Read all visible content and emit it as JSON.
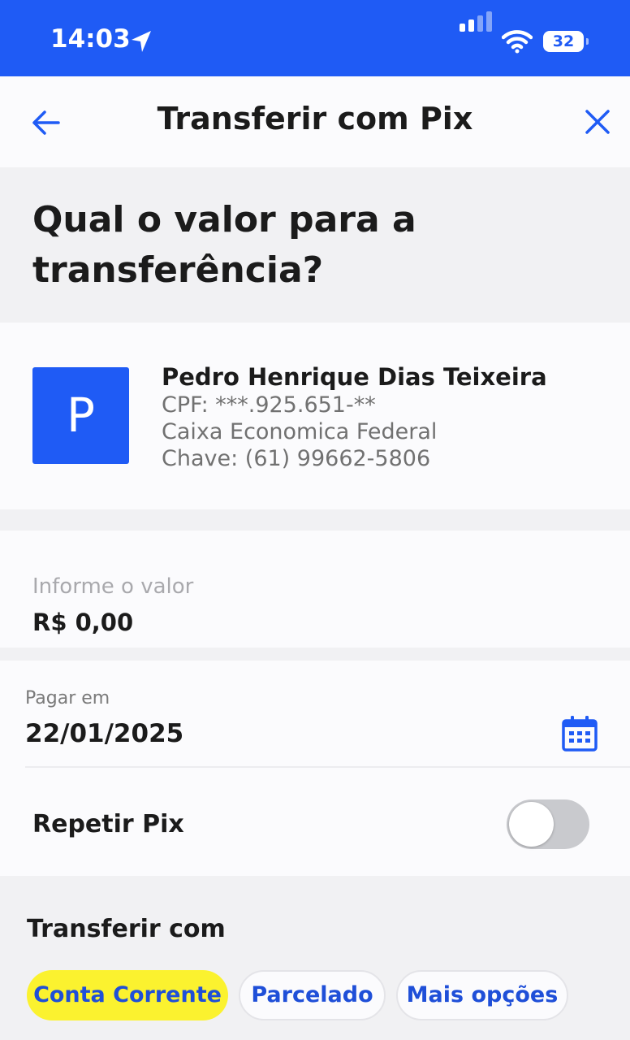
{
  "status_bar": {
    "time": "14:03",
    "battery": "32"
  },
  "header": {
    "title": "Transferir com Pix"
  },
  "question": "Qual o valor para a transferência?",
  "recipient": {
    "initial": "P",
    "name": "Pedro Henrique Dias Teixeira",
    "cpf": "CPF: ***.925.651-**",
    "bank": "Caixa Economica Federal",
    "key": "Chave: (61) 99662-5806"
  },
  "amount": {
    "label": "Informe o valor",
    "value": "R$ 0,00"
  },
  "schedule": {
    "label": "Pagar em",
    "date": "22/01/2025"
  },
  "repeat": {
    "label": "Repetir Pix",
    "enabled": false
  },
  "transfer_with": {
    "label": "Transferir com",
    "options": [
      {
        "label": "Conta Corrente",
        "selected": true
      },
      {
        "label": "Parcelado",
        "selected": false
      },
      {
        "label": "Mais opções",
        "selected": false
      }
    ]
  },
  "colors": {
    "brand_blue": "#1f5bf5",
    "selected_chip": "#fbf22f",
    "link_blue": "#1f4fd8"
  }
}
